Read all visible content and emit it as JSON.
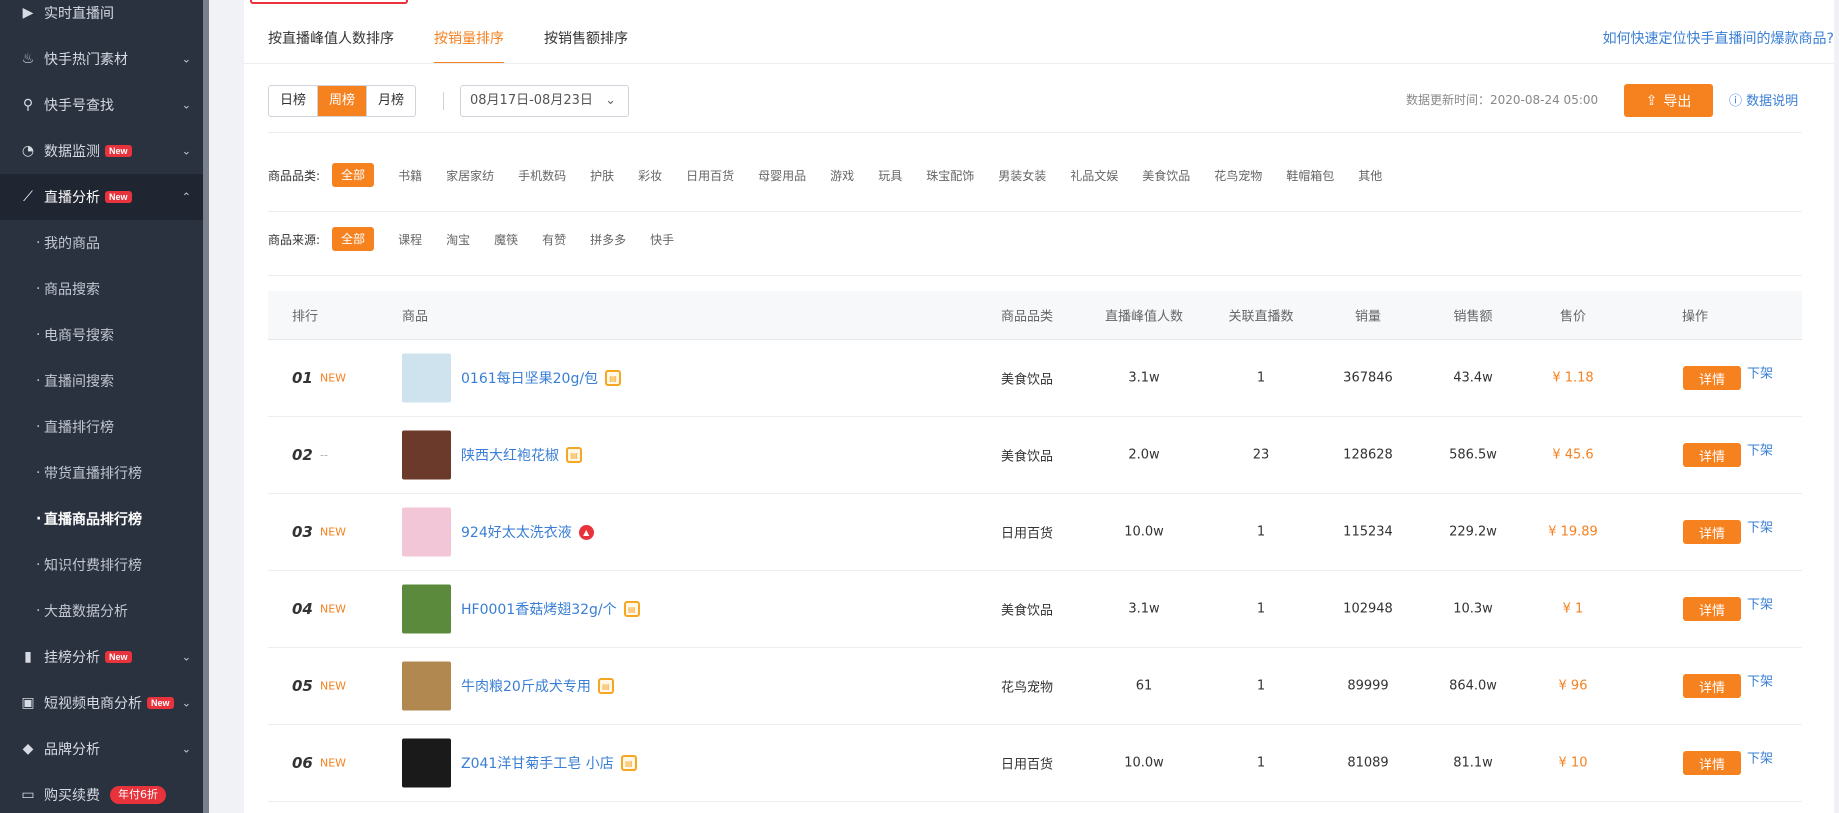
{
  "sidebar": {
    "items": [
      {
        "label": "实时直播间",
        "icon": "play-icon",
        "new": false,
        "chevron": false
      },
      {
        "label": "快手热门素材",
        "icon": "flame-icon",
        "new": false,
        "chevron": true
      },
      {
        "label": "快手号查找",
        "icon": "search-icon",
        "new": false,
        "chevron": true
      },
      {
        "label": "数据监测",
        "icon": "monitor-icon",
        "new": true,
        "chevron": true
      },
      {
        "label": "直播分析",
        "icon": "trend-icon",
        "new": true,
        "chevron": true
      }
    ],
    "new_badge": "New",
    "sub_items": [
      "我的商品",
      "商品搜索",
      "电商号搜索",
      "直播间搜索",
      "直播排行榜",
      "带货直播排行榜",
      "直播商品排行榜",
      "知识付费排行榜",
      "大盘数据分析"
    ],
    "after_items": [
      {
        "label": "挂榜分析",
        "new": true
      },
      {
        "label": "短视频电商分析",
        "new": true
      },
      {
        "label": "品牌分析",
        "new": false
      }
    ],
    "renew": {
      "label": "购买续费",
      "promo": "年付6折"
    }
  },
  "tabs": [
    "按直播峰值人数排序",
    "按销量排序",
    "按销售额排序"
  ],
  "help_link": "如何快速定位快手直播间的爆款商品?",
  "period": {
    "options": [
      "日榜",
      "周榜",
      "月榜"
    ],
    "selected": "周榜"
  },
  "date_range": "08月17日-08月23日",
  "update_time": "数据更新时间：2020-08-24 05:00",
  "export_label": "导出",
  "data_desc_label": "数据说明",
  "category_filter": {
    "label": "商品品类:",
    "options": [
      "全部",
      "书籍",
      "家居家纺",
      "手机数码",
      "护肤",
      "彩妆",
      "日用百货",
      "母婴用品",
      "游戏",
      "玩具",
      "珠宝配饰",
      "男装女装",
      "礼品文娱",
      "美食饮品",
      "花鸟宠物",
      "鞋帽箱包",
      "其他"
    ]
  },
  "source_filter": {
    "label": "商品来源:",
    "options": [
      "全部",
      "课程",
      "淘宝",
      "魔筷",
      "有赞",
      "拼多多",
      "快手"
    ]
  },
  "table": {
    "headers": [
      "排行",
      "商品",
      "商品品类",
      "直播峰值人数",
      "关联直播数",
      "销量",
      "销售额",
      "售价",
      "操作"
    ],
    "detail_label": "详情",
    "offshelf_label": "下架",
    "rows": [
      {
        "rank": "01",
        "tag": "NEW",
        "name": "0161每日坚果20g/包",
        "icon": "shop",
        "category": "美食饮品",
        "peak": "3.1w",
        "streams": "1",
        "sales": "367846",
        "revenue": "43.4w",
        "price": "¥ 1.18",
        "thumb": "#cfe3ee"
      },
      {
        "rank": "02",
        "tag": "--",
        "name": "陕西大红袍花椒",
        "icon": "shop",
        "category": "美食饮品",
        "peak": "2.0w",
        "streams": "23",
        "sales": "128628",
        "revenue": "586.5w",
        "price": "¥ 45.6",
        "thumb": "#6b3a2a"
      },
      {
        "rank": "03",
        "tag": "NEW",
        "name": "924好太太洗衣液",
        "icon": "hot",
        "category": "日用百货",
        "peak": "10.0w",
        "streams": "1",
        "sales": "115234",
        "revenue": "229.2w",
        "price": "¥ 19.89",
        "thumb": "#f2c6d6"
      },
      {
        "rank": "04",
        "tag": "NEW",
        "name": "HF0001香菇烤翅32g/个",
        "icon": "shop",
        "category": "美食饮品",
        "peak": "3.1w",
        "streams": "1",
        "sales": "102948",
        "revenue": "10.3w",
        "price": "¥ 1",
        "thumb": "#5c8a3c"
      },
      {
        "rank": "05",
        "tag": "NEW",
        "name": "牛肉粮20斤成犬专用",
        "icon": "shop",
        "category": "花鸟宠物",
        "peak": "61",
        "streams": "1",
        "sales": "89999",
        "revenue": "864.0w",
        "price": "¥ 96",
        "thumb": "#b08850"
      },
      {
        "rank": "06",
        "tag": "NEW",
        "name": "Z041洋甘菊手工皂 小店",
        "icon": "shop",
        "category": "日用百货",
        "peak": "10.0w",
        "streams": "1",
        "sales": "81089",
        "revenue": "81.1w",
        "price": "¥ 10",
        "thumb": "#1a1a1a"
      }
    ]
  }
}
